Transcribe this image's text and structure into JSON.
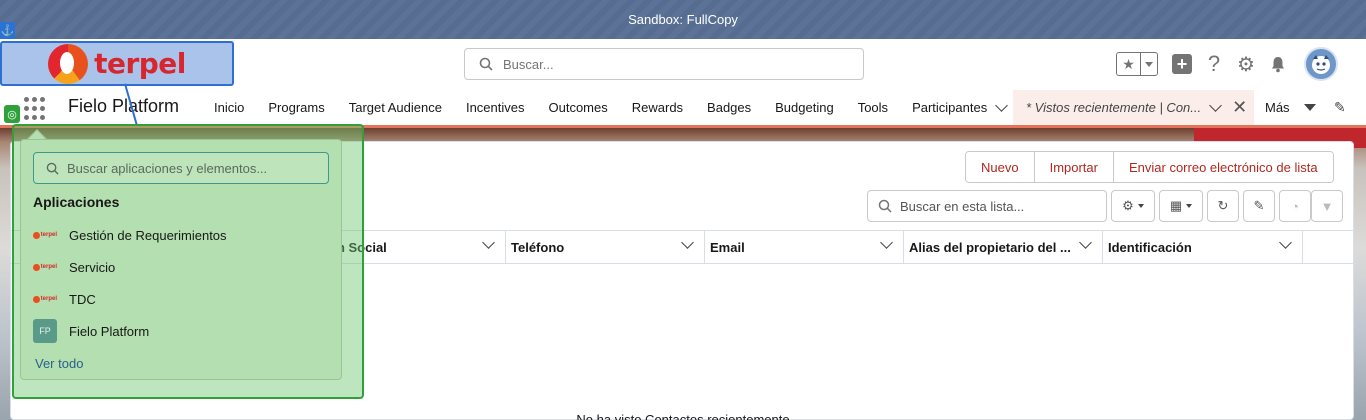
{
  "sandbox": {
    "label": "Sandbox: FullCopy",
    "anchor_glyph": "⚓"
  },
  "header": {
    "logo_text": "terpel",
    "search_placeholder": "Buscar...",
    "icons": [
      "star-icon",
      "dropdown-icon",
      "add-icon",
      "help-icon",
      "setup-gear-icon",
      "notification-bell-icon",
      "avatar"
    ],
    "help_glyph": "?",
    "gear_glyph": "⚙",
    "bell_glyph": "🔔",
    "plus_glyph": "+"
  },
  "nav": {
    "app_name": "Fielo Platform",
    "items": [
      "Inicio",
      "Programs",
      "Target Audience",
      "Incentives",
      "Outcomes",
      "Rewards",
      "Badges",
      "Budgeting",
      "Tools",
      "Participantes"
    ],
    "active_tab": "* Vistos recientemente | Con...",
    "close_glyph": "✕",
    "more_label": "Más",
    "edit_glyph": "✎"
  },
  "list": {
    "buttons": [
      "Nuevo",
      "Importar",
      "Enviar correo electrónico de lista"
    ],
    "search_placeholder": "Buscar en esta lista...",
    "columns": [
      "on Social",
      "Teléfono",
      "Email",
      "Alias del propietario del ...",
      "Identificación"
    ],
    "empty_message": "No ha visto Contactos recientemente"
  },
  "app_launcher": {
    "search_placeholder": "Buscar aplicaciones y elementos...",
    "section_title": "Aplicaciones",
    "apps": [
      {
        "label": "Gestión de Requerimientos",
        "icon": "terpel-logo"
      },
      {
        "label": "Servicio",
        "icon": "terpel-logo"
      },
      {
        "label": "TDC",
        "icon": "terpel-logo"
      },
      {
        "label": "Fielo Platform",
        "icon": "fp-badge",
        "badge": "FP"
      }
    ],
    "mini_logo_text": "terpel",
    "view_all": "Ver todo"
  },
  "colors": {
    "sandbox_bar": "#566c90",
    "accent_red": "#b1281f",
    "nav_underline": "#e4735b",
    "overlay_green": "#2ea13b",
    "highlight_blue": "#2e6fd0"
  }
}
